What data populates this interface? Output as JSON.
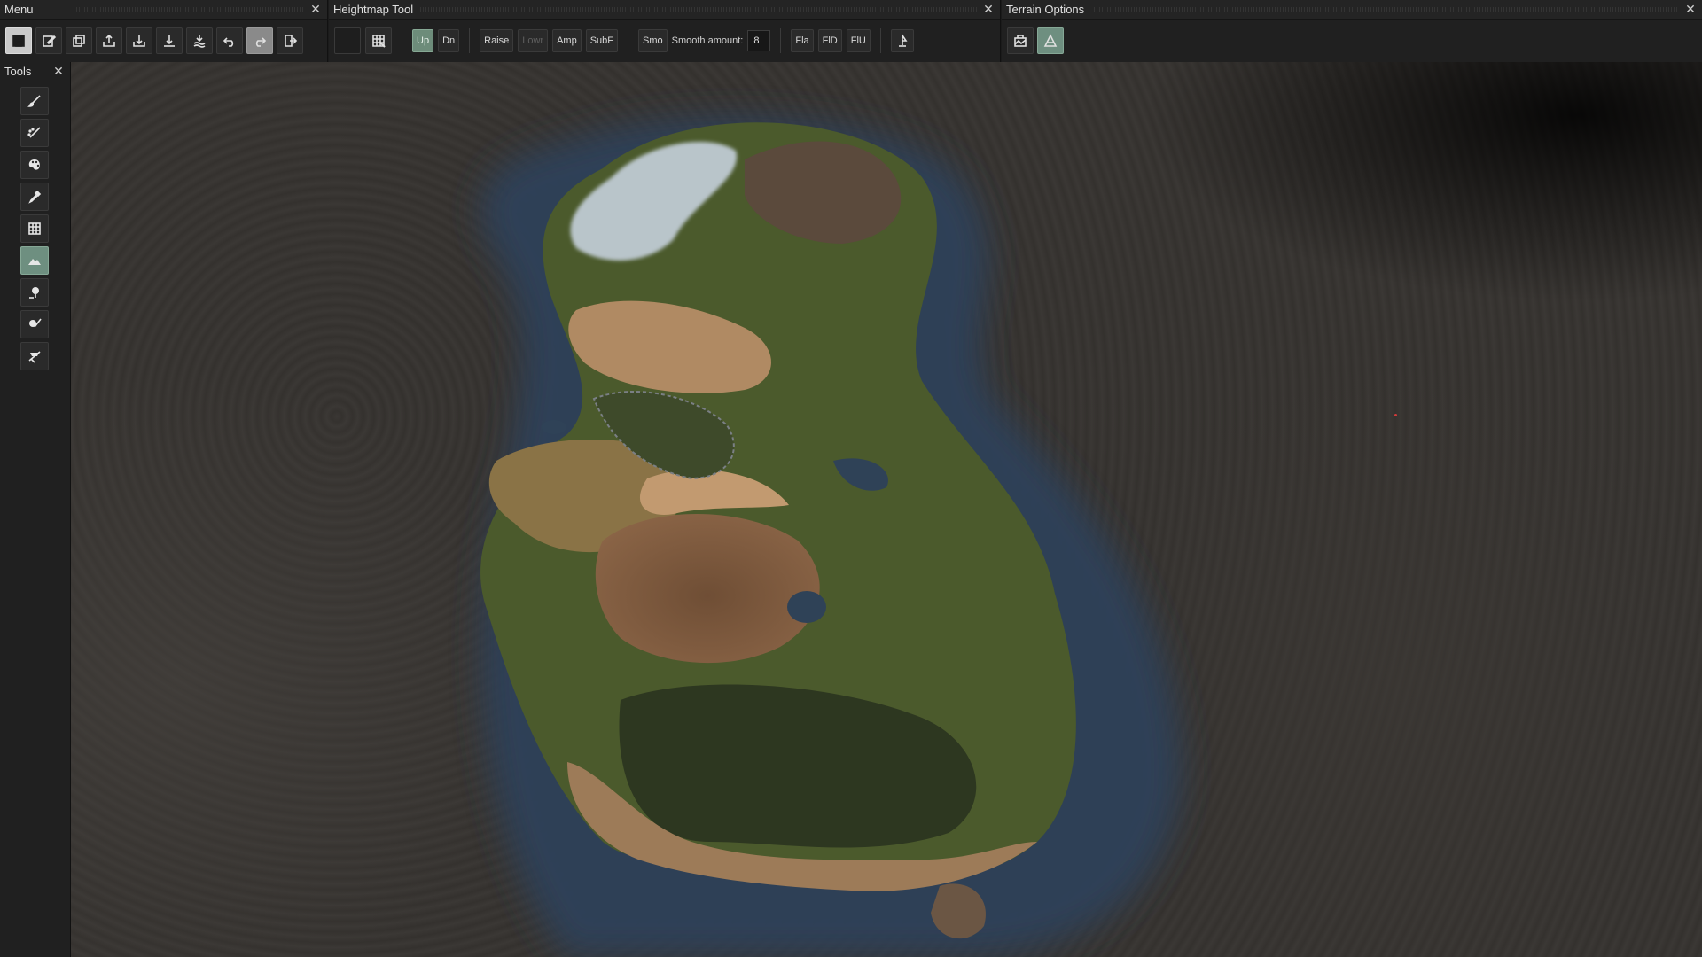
{
  "menu_panel": {
    "title": "Menu"
  },
  "heightmap_panel": {
    "title": "Heightmap Tool",
    "dir_up": "Up",
    "dir_down": "Dn",
    "raise": "Raise",
    "lower": "Lowr",
    "amp": "Amp",
    "subf": "SubF",
    "smo": "Smo",
    "smooth_label": "Smooth amount:",
    "smooth_value": "8",
    "fla": "Fla",
    "fld": "FlD",
    "flu": "FlU"
  },
  "terrain_panel": {
    "title": "Terrain Options"
  },
  "tools_panel": {
    "title": "Tools"
  },
  "close_glyph": "✕",
  "colors": {
    "accent_green": "#6e8f80",
    "water": "#2f4257",
    "grass": "#4a5a2c",
    "sand": "#b08a63",
    "snow": "#b7c3c8",
    "rock": "#3a3734"
  }
}
